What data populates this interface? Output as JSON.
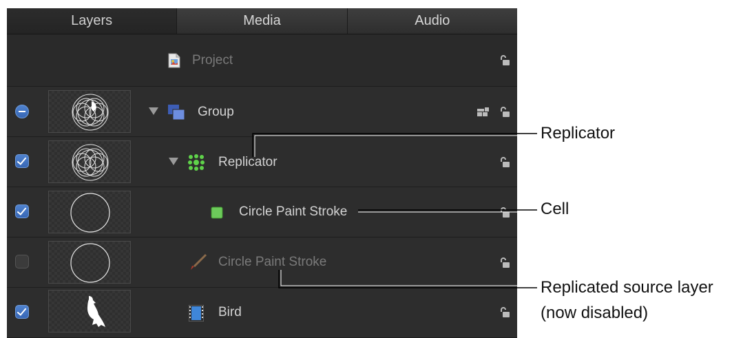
{
  "tabs": [
    "Layers",
    "Media",
    "Audio"
  ],
  "rows": {
    "project": {
      "label": "Project"
    },
    "group": {
      "label": "Group"
    },
    "replicator": {
      "label": "Replicator"
    },
    "cell": {
      "label": "Circle Paint Stroke"
    },
    "source": {
      "label": "Circle Paint Stroke"
    },
    "bird": {
      "label": "Bird"
    }
  },
  "annotations": {
    "replicator": "Replicator",
    "cell": "Cell",
    "source_line1": "Replicated source layer",
    "source_line2": "(now disabled)"
  },
  "colors": {
    "checkbox_on": "#3f74c4",
    "panel_bg": "#2b2b2b",
    "annotation_line": "#000000"
  },
  "icons": {
    "project": "project-document-icon",
    "group": "group-stack-icon",
    "replicator": "replicator-icon",
    "cell": "green-square-icon",
    "source": "paint-brush-icon",
    "bird": "film-strip-icon",
    "lock": "lock-icon"
  }
}
